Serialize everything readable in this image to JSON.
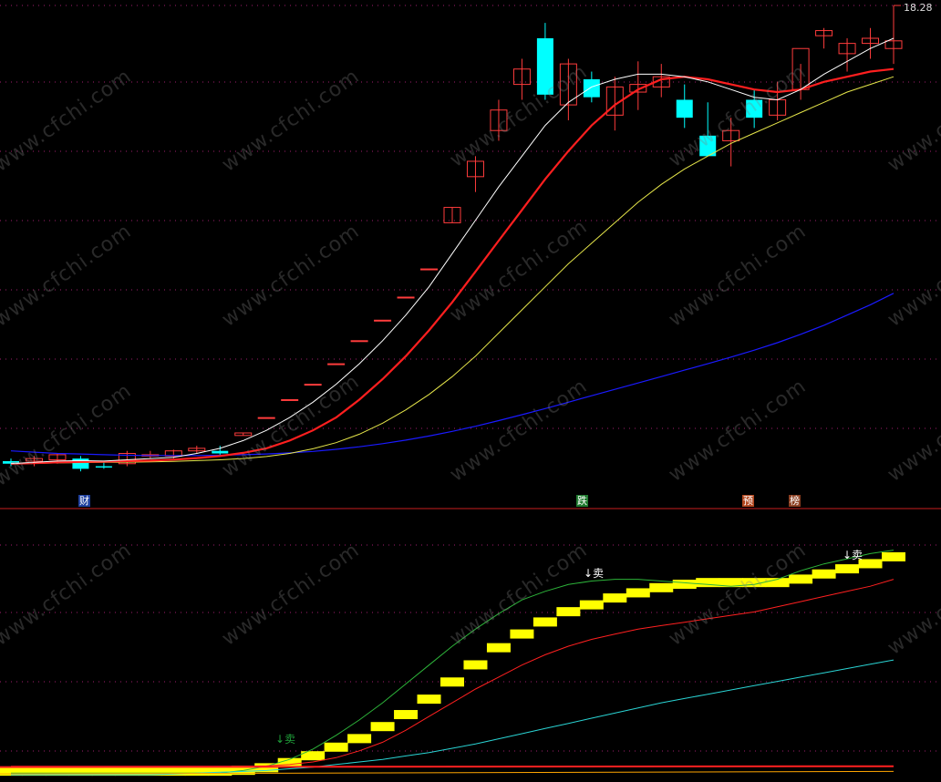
{
  "price_high_label": "18.28",
  "watermark": "www.cfchi.com",
  "event_tags": {
    "cai": "财",
    "die": "跌",
    "yu": "预",
    "bang": "榜"
  },
  "signals": {
    "sell_1": "↓卖",
    "sell_2": "↓卖",
    "sell_3": "↓卖"
  },
  "colors": {
    "background": "#000000",
    "up_candle": "#ff3c3c",
    "down_candle": "#00ffff",
    "ma_white": "#ffffff",
    "ma_red": "#ff1f1f",
    "ma_yellow": "#e6e64a",
    "ma_blue": "#1a1aff",
    "grid": "#a01e6e",
    "divider": "#c81e1e",
    "band": "#ffff00"
  },
  "chart_data": {
    "type": "candlestick",
    "price_high": 18.28,
    "candles": [
      {
        "o": 0.5,
        "h": 0.6,
        "l": 0.3,
        "c": 0.4
      },
      {
        "o": 0.5,
        "h": 0.7,
        "l": 0.3,
        "c": 0.6
      },
      {
        "o": 0.55,
        "h": 0.8,
        "l": 0.4,
        "c": 0.75
      },
      {
        "o": 0.6,
        "h": 0.7,
        "l": 0.1,
        "c": 0.2
      },
      {
        "o": 0.3,
        "h": 0.5,
        "l": 0.2,
        "c": 0.25
      },
      {
        "o": 0.4,
        "h": 0.9,
        "l": 0.3,
        "c": 0.8
      },
      {
        "o": 0.7,
        "h": 0.9,
        "l": 0.6,
        "c": 0.75
      },
      {
        "o": 0.7,
        "h": 0.95,
        "l": 0.6,
        "c": 0.9
      },
      {
        "o": 0.9,
        "h": 1.1,
        "l": 0.8,
        "c": 1.0
      },
      {
        "o": 0.9,
        "h": 1.1,
        "l": 0.7,
        "c": 0.8
      },
      {
        "o": 1.5,
        "h": 1.6,
        "l": 1.5,
        "c": 1.6
      },
      {
        "o": 2.2,
        "h": 2.2,
        "l": 2.2,
        "c": 2.2
      },
      {
        "o": 2.9,
        "h": 2.9,
        "l": 2.9,
        "c": 2.9
      },
      {
        "o": 3.5,
        "h": 3.5,
        "l": 3.5,
        "c": 3.5
      },
      {
        "o": 4.3,
        "h": 4.3,
        "l": 4.3,
        "c": 4.3
      },
      {
        "o": 5.2,
        "h": 5.2,
        "l": 5.2,
        "c": 5.2
      },
      {
        "o": 6.0,
        "h": 6.0,
        "l": 6.0,
        "c": 6.0
      },
      {
        "o": 6.9,
        "h": 6.9,
        "l": 6.9,
        "c": 6.9
      },
      {
        "o": 8.0,
        "h": 8.0,
        "l": 8.0,
        "c": 8.0
      },
      {
        "o": 9.8,
        "h": 10.4,
        "l": 9.8,
        "c": 10.4
      },
      {
        "o": 11.6,
        "h": 12.4,
        "l": 11.0,
        "c": 12.2
      },
      {
        "o": 13.4,
        "h": 14.6,
        "l": 13.0,
        "c": 14.2
      },
      {
        "o": 15.2,
        "h": 16.2,
        "l": 14.6,
        "c": 15.8
      },
      {
        "o": 17.0,
        "h": 17.6,
        "l": 14.6,
        "c": 14.8
      },
      {
        "o": 14.4,
        "h": 16.2,
        "l": 13.8,
        "c": 16.0
      },
      {
        "o": 15.4,
        "h": 15.7,
        "l": 14.5,
        "c": 14.7
      },
      {
        "o": 14.0,
        "h": 15.5,
        "l": 13.4,
        "c": 15.1
      },
      {
        "o": 14.9,
        "h": 16.1,
        "l": 14.2,
        "c": 15.2
      },
      {
        "o": 15.1,
        "h": 16.0,
        "l": 14.7,
        "c": 15.5
      },
      {
        "o": 14.6,
        "h": 15.2,
        "l": 13.5,
        "c": 13.9
      },
      {
        "o": 13.2,
        "h": 14.5,
        "l": 12.4,
        "c": 12.4
      },
      {
        "o": 13.0,
        "h": 13.9,
        "l": 12.0,
        "c": 13.4
      },
      {
        "o": 14.6,
        "h": 15.0,
        "l": 13.5,
        "c": 13.9
      },
      {
        "o": 14.0,
        "h": 15.3,
        "l": 13.8,
        "c": 14.6
      },
      {
        "o": 15.0,
        "h": 16.0,
        "l": 14.6,
        "c": 16.6
      },
      {
        "o": 17.1,
        "h": 17.4,
        "l": 16.6,
        "c": 17.3
      },
      {
        "o": 16.4,
        "h": 17.0,
        "l": 15.7,
        "c": 16.8
      },
      {
        "o": 16.8,
        "h": 17.4,
        "l": 16.2,
        "c": 17.0
      },
      {
        "o": 16.6,
        "h": 18.28,
        "l": 16.0,
        "c": 16.9
      }
    ],
    "ma_white": [
      0.4,
      0.45,
      0.5,
      0.52,
      0.5,
      0.55,
      0.6,
      0.65,
      0.8,
      1.0,
      1.3,
      1.7,
      2.2,
      2.8,
      3.5,
      4.3,
      5.2,
      6.2,
      7.3,
      8.6,
      9.9,
      11.2,
      12.4,
      13.6,
      14.5,
      15.1,
      15.4,
      15.6,
      15.6,
      15.5,
      15.3,
      15.0,
      14.7,
      14.6,
      15.0,
      15.6,
      16.1,
      16.6,
      17.0
    ],
    "ma_red": [
      0.4,
      0.42,
      0.45,
      0.47,
      0.48,
      0.5,
      0.52,
      0.56,
      0.62,
      0.7,
      0.82,
      1.0,
      1.3,
      1.7,
      2.2,
      2.9,
      3.7,
      4.6,
      5.6,
      6.7,
      7.9,
      9.1,
      10.3,
      11.5,
      12.6,
      13.6,
      14.4,
      15.0,
      15.4,
      15.5,
      15.4,
      15.2,
      15.0,
      14.9,
      15.0,
      15.3,
      15.5,
      15.7,
      15.8
    ],
    "ma_yellow": [
      0.4,
      0.41,
      0.43,
      0.44,
      0.45,
      0.46,
      0.47,
      0.49,
      0.52,
      0.55,
      0.6,
      0.68,
      0.8,
      0.98,
      1.22,
      1.55,
      1.98,
      2.5,
      3.1,
      3.8,
      4.6,
      5.5,
      6.4,
      7.3,
      8.2,
      9.0,
      9.8,
      10.6,
      11.3,
      11.9,
      12.4,
      12.9,
      13.3,
      13.7,
      14.1,
      14.5,
      14.9,
      15.2,
      15.5
    ],
    "ma_blue": [
      0.9,
      0.85,
      0.8,
      0.78,
      0.75,
      0.73,
      0.72,
      0.72,
      0.72,
      0.73,
      0.75,
      0.78,
      0.82,
      0.88,
      0.96,
      1.06,
      1.18,
      1.32,
      1.48,
      1.66,
      1.86,
      2.08,
      2.31,
      2.55,
      2.8,
      3.05,
      3.3,
      3.55,
      3.8,
      4.05,
      4.3,
      4.56,
      4.83,
      5.12,
      5.45,
      5.8,
      6.2,
      6.6,
      7.05
    ],
    "band": [
      0.1,
      0.1,
      0.1,
      0.1,
      0.1,
      0.1,
      0.1,
      0.1,
      0.1,
      0.1,
      0.15,
      0.3,
      0.6,
      1.0,
      1.5,
      2.0,
      2.7,
      3.4,
      4.3,
      5.3,
      6.3,
      7.3,
      8.1,
      8.8,
      9.4,
      9.8,
      10.2,
      10.5,
      10.8,
      11.0,
      11.1,
      11.1,
      11.1,
      11.1,
      11.3,
      11.6,
      11.9,
      12.2,
      12.6
    ],
    "band_upper": [
      0.2,
      0.2,
      0.2,
      0.2,
      0.2,
      0.2,
      0.2,
      0.2,
      0.2,
      0.2,
      0.35,
      0.6,
      1.0,
      1.6,
      2.4,
      3.3,
      4.3,
      5.4,
      6.5,
      7.6,
      8.6,
      9.5,
      10.3,
      10.8,
      11.2,
      11.4,
      11.5,
      11.5,
      11.4,
      11.3,
      11.2,
      11.1,
      11.2,
      11.5,
      12.0,
      12.4,
      12.7,
      13.0,
      13.2
    ],
    "osc_red": [
      0.6,
      0.6,
      0.6,
      0.6,
      0.6,
      0.6,
      0.6,
      0.6,
      0.6,
      0.6,
      0.6,
      0.62,
      0.7,
      0.85,
      1.1,
      1.5,
      2.0,
      2.7,
      3.5,
      4.3,
      5.1,
      5.8,
      6.5,
      7.1,
      7.6,
      8.0,
      8.3,
      8.6,
      8.8,
      9.0,
      9.2,
      9.4,
      9.6,
      9.9,
      10.2,
      10.5,
      10.8,
      11.1,
      11.5
    ],
    "osc_cyan": [
      0.1,
      0.1,
      0.1,
      0.1,
      0.1,
      0.1,
      0.1,
      0.15,
      0.2,
      0.25,
      0.3,
      0.35,
      0.45,
      0.55,
      0.7,
      0.85,
      1.0,
      1.2,
      1.4,
      1.65,
      1.9,
      2.2,
      2.5,
      2.8,
      3.1,
      3.4,
      3.7,
      4.0,
      4.3,
      4.55,
      4.8,
      5.05,
      5.3,
      5.55,
      5.8,
      6.05,
      6.3,
      6.55,
      6.8
    ]
  }
}
